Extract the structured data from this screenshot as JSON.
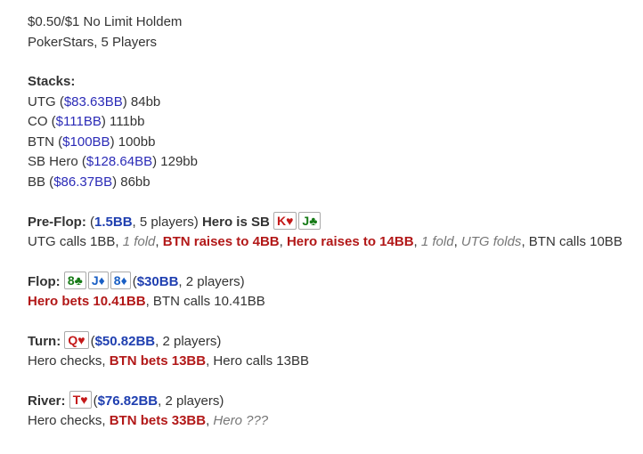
{
  "header": {
    "game": "$0.50/$1 No Limit Holdem",
    "site": "PokerStars, 5 Players"
  },
  "stacks": {
    "title": "Stacks:",
    "players": [
      {
        "pos": "UTG",
        "amount": "$83.63BB",
        "bb": "84bb"
      },
      {
        "pos": "CO",
        "amount": "$111BB",
        "bb": "111bb"
      },
      {
        "pos": "BTN",
        "amount": "$100BB",
        "bb": "100bb"
      },
      {
        "pos": "SB Hero",
        "amount": "$128.64BB",
        "bb": "129bb"
      },
      {
        "pos": "BB",
        "amount": "$86.37BB",
        "bb": "86bb"
      }
    ]
  },
  "preflop": {
    "label": "Pre-Flop:",
    "pot": "1.5BB",
    "players": "5 players",
    "hero_is": "Hero is SB",
    "hero_cards": [
      {
        "rank": "K",
        "suit": "♥",
        "color": "h"
      },
      {
        "rank": "J",
        "suit": "♣",
        "color": "c"
      }
    ],
    "actions": [
      {
        "text": "UTG calls 1BB",
        "style": "plain"
      },
      {
        "text": "1 fold",
        "style": "gray"
      },
      {
        "text": "BTN raises to 4BB",
        "style": "red"
      },
      {
        "text": "Hero raises to 14BB",
        "style": "red"
      },
      {
        "text": "1 fold",
        "style": "gray"
      },
      {
        "text": "UTG folds",
        "style": "gray"
      },
      {
        "text": "BTN calls 10BB",
        "style": "plain"
      }
    ]
  },
  "flop": {
    "label": "Flop:",
    "cards": [
      {
        "rank": "8",
        "suit": "♣",
        "color": "c"
      },
      {
        "rank": "J",
        "suit": "♦",
        "color": "d"
      },
      {
        "rank": "8",
        "suit": "♦",
        "color": "d"
      }
    ],
    "pot": "$30BB",
    "players": "2 players",
    "actions": [
      {
        "text": "Hero bets 10.41BB",
        "style": "red"
      },
      {
        "text": "BTN calls 10.41BB",
        "style": "plain"
      }
    ]
  },
  "turn": {
    "label": "Turn:",
    "cards": [
      {
        "rank": "Q",
        "suit": "♥",
        "color": "h"
      }
    ],
    "pot": "$50.82BB",
    "players": "2 players",
    "actions": [
      {
        "text": "Hero checks",
        "style": "plain"
      },
      {
        "text": "BTN bets 13BB",
        "style": "red"
      },
      {
        "text": "Hero calls 13BB",
        "style": "plain"
      }
    ]
  },
  "river": {
    "label": "River:",
    "cards": [
      {
        "rank": "T",
        "suit": "♥",
        "color": "h"
      }
    ],
    "pot": "$76.82BB",
    "players": "2 players",
    "actions": [
      {
        "text": "Hero checks",
        "style": "plain"
      },
      {
        "text": "BTN bets 33BB",
        "style": "red"
      },
      {
        "text": "Hero ???",
        "style": "gray-hero"
      }
    ]
  }
}
